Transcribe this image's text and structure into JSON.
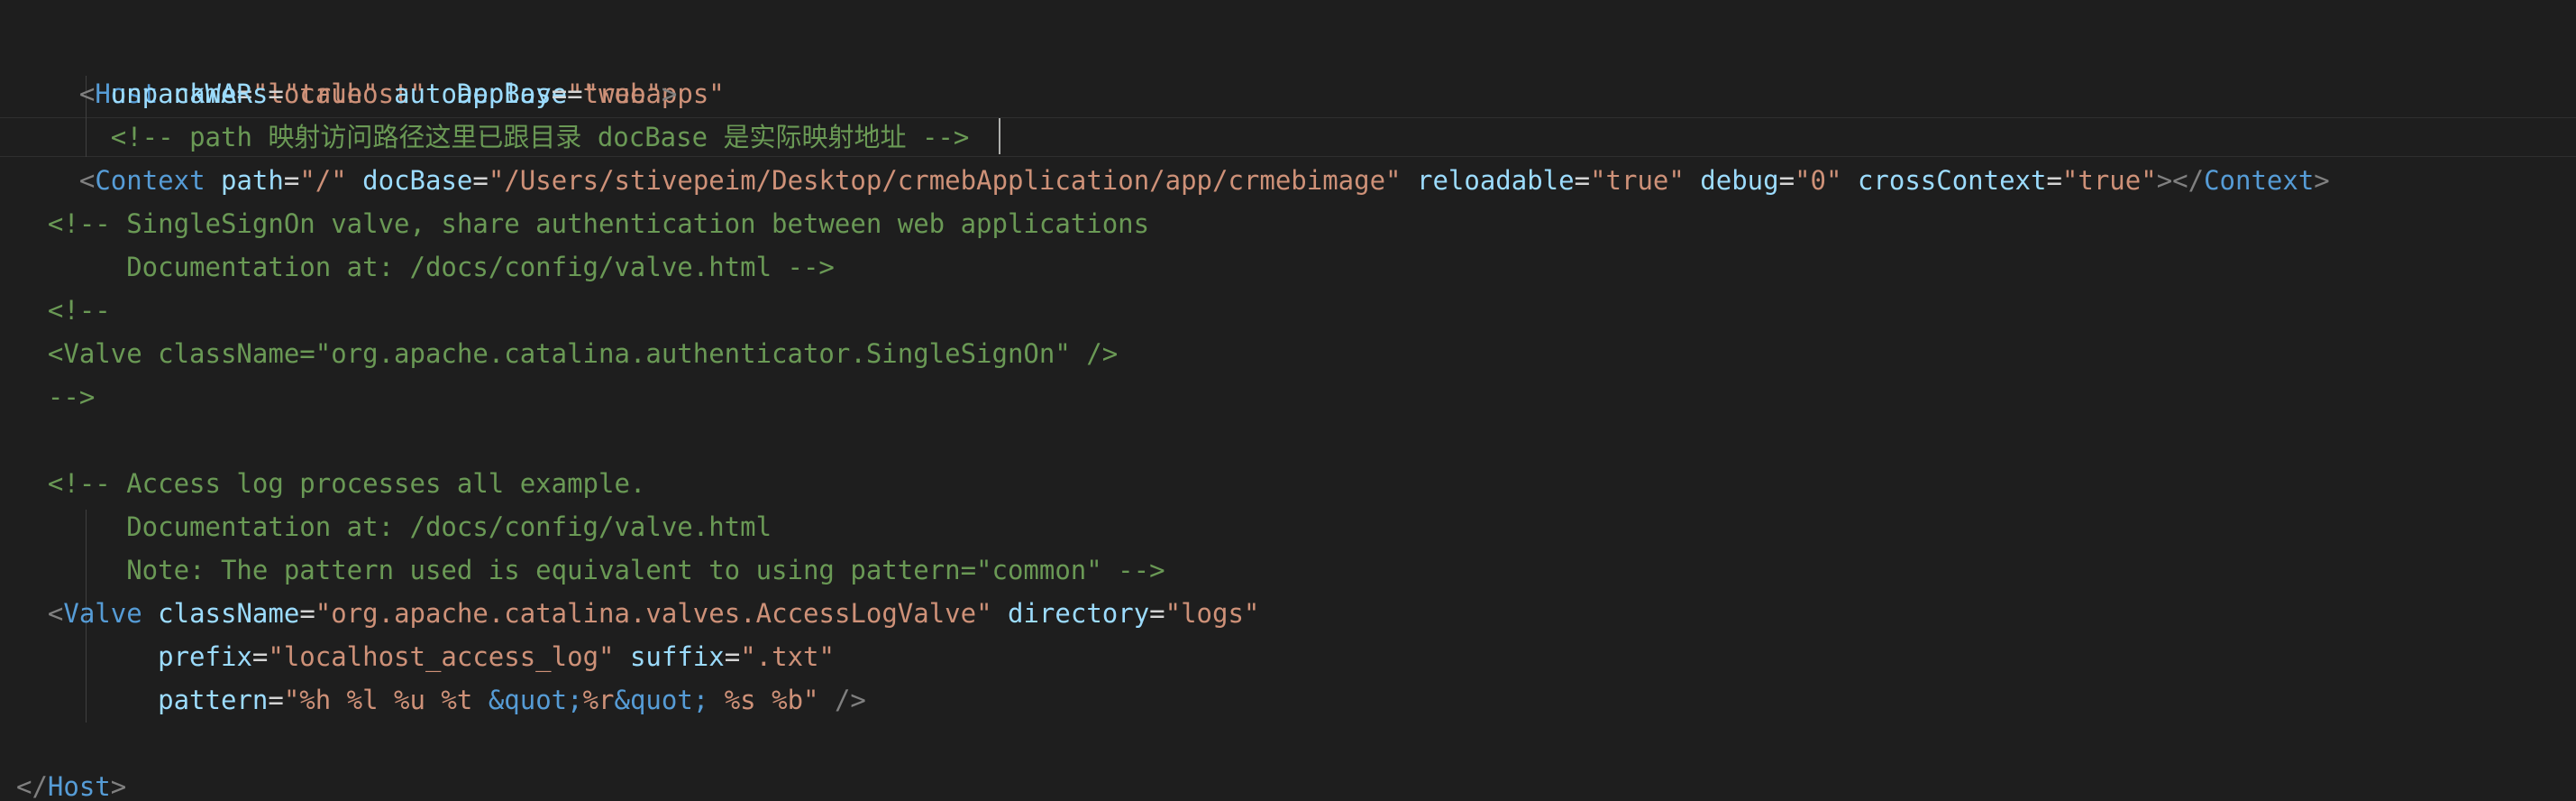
{
  "host_open": {
    "lt": "<",
    "tag": "Host",
    "attrs": [
      {
        "name": "name",
        "value": "\"localhost\""
      },
      {
        "name": "appBase",
        "value": "\"webapps\""
      }
    ]
  },
  "host_line2": {
    "attrs": [
      {
        "name": "unpackWARs",
        "value": "\"true\""
      },
      {
        "name": "autoDeploy",
        "value": "\"true\""
      }
    ],
    "gt": ">"
  },
  "comment_path": "<!-- path 映射访问路径这里已跟目录 docBase 是实际映射地址 -->",
  "context": {
    "lt": "<",
    "tag": "Context",
    "attrs": [
      {
        "name": "path",
        "value": "\"/\""
      },
      {
        "name": "docBase",
        "value": "\"/Users/stivepeim/Desktop/crmebApplication/app/crmebimage\""
      },
      {
        "name": "reloadable",
        "value": "\"true\""
      },
      {
        "name": "debug",
        "value": "\"0\""
      },
      {
        "name": "crossContext",
        "value": "\"true\""
      }
    ],
    "gt": ">",
    "close_lt": "</",
    "close_tag": "Context",
    "close_gt": ">"
  },
  "comment_sso": [
    "<!-- SingleSignOn valve, share authentication between web applications",
    "     Documentation at: /docs/config/valve.html -->",
    "<!--",
    "<Valve className=\"org.apache.catalina.authenticator.SingleSignOn\" />",
    "-->"
  ],
  "comment_access": [
    "<!-- Access log processes all example.",
    "     Documentation at: /docs/config/valve.html",
    "     Note: The pattern used is equivalent to using pattern=\"common\" -->"
  ],
  "valve": {
    "lt": "<",
    "tag": "Valve",
    "class_attr": {
      "name": "className",
      "value": "\"org.apache.catalina.valves.AccessLogValve\""
    },
    "dir_attr": {
      "name": "directory",
      "value": "\"logs\""
    },
    "prefix_attr": {
      "name": "prefix",
      "value": "\"localhost_access_log\""
    },
    "suffix_attr": {
      "name": "suffix",
      "value": "\".txt\""
    },
    "pattern_name": "pattern",
    "pattern_parts": [
      "\"%h %l %u %t ",
      "&quot;",
      "%r",
      "&quot;",
      " %s %b\""
    ],
    "close": "/>"
  },
  "host_close": {
    "lt": "</",
    "tag": "Host",
    "gt": ">"
  },
  "punct": {
    "eq": "="
  },
  "colors": {
    "background": "#1e1e1e",
    "tag": "#569cd6",
    "attribute": "#9cdcfe",
    "string": "#ce9178",
    "comment": "#6a9955",
    "punctuation": "#808080"
  }
}
